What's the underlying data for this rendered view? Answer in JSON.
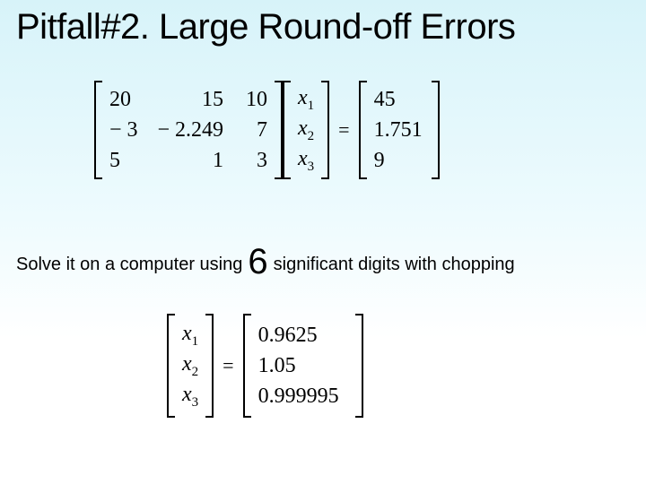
{
  "title": "Pitfall#2. Large Round-off Errors",
  "equation1": {
    "A": [
      [
        "20",
        "15",
        "10"
      ],
      [
        "− 3",
        "− 2.249",
        "7"
      ],
      [
        "5",
        "1",
        "3"
      ]
    ],
    "x": [
      "x",
      "x",
      "x"
    ],
    "x_sub": [
      "1",
      "2",
      "3"
    ],
    "eq": "=",
    "b": [
      "45",
      "1.751",
      "9"
    ]
  },
  "line2": {
    "pre": "Solve it on a computer using",
    "digits": "6",
    "post": "significant digits with chopping"
  },
  "equation2": {
    "x": [
      "x",
      "x",
      "x"
    ],
    "x_sub": [
      "1",
      "2",
      "3"
    ],
    "eq": "=",
    "sol": [
      "0.9625",
      "1.05",
      "0.999995"
    ]
  },
  "chart_data": {
    "type": "table",
    "title": "Linear system Ax = b and solution (6 sig. digits, chopping)",
    "A": [
      [
        20,
        15,
        10
      ],
      [
        -3,
        -2.249,
        7
      ],
      [
        5,
        1,
        3
      ]
    ],
    "b": [
      45,
      1.751,
      9
    ],
    "x_solution": [
      0.9625,
      1.05,
      0.999995
    ]
  }
}
